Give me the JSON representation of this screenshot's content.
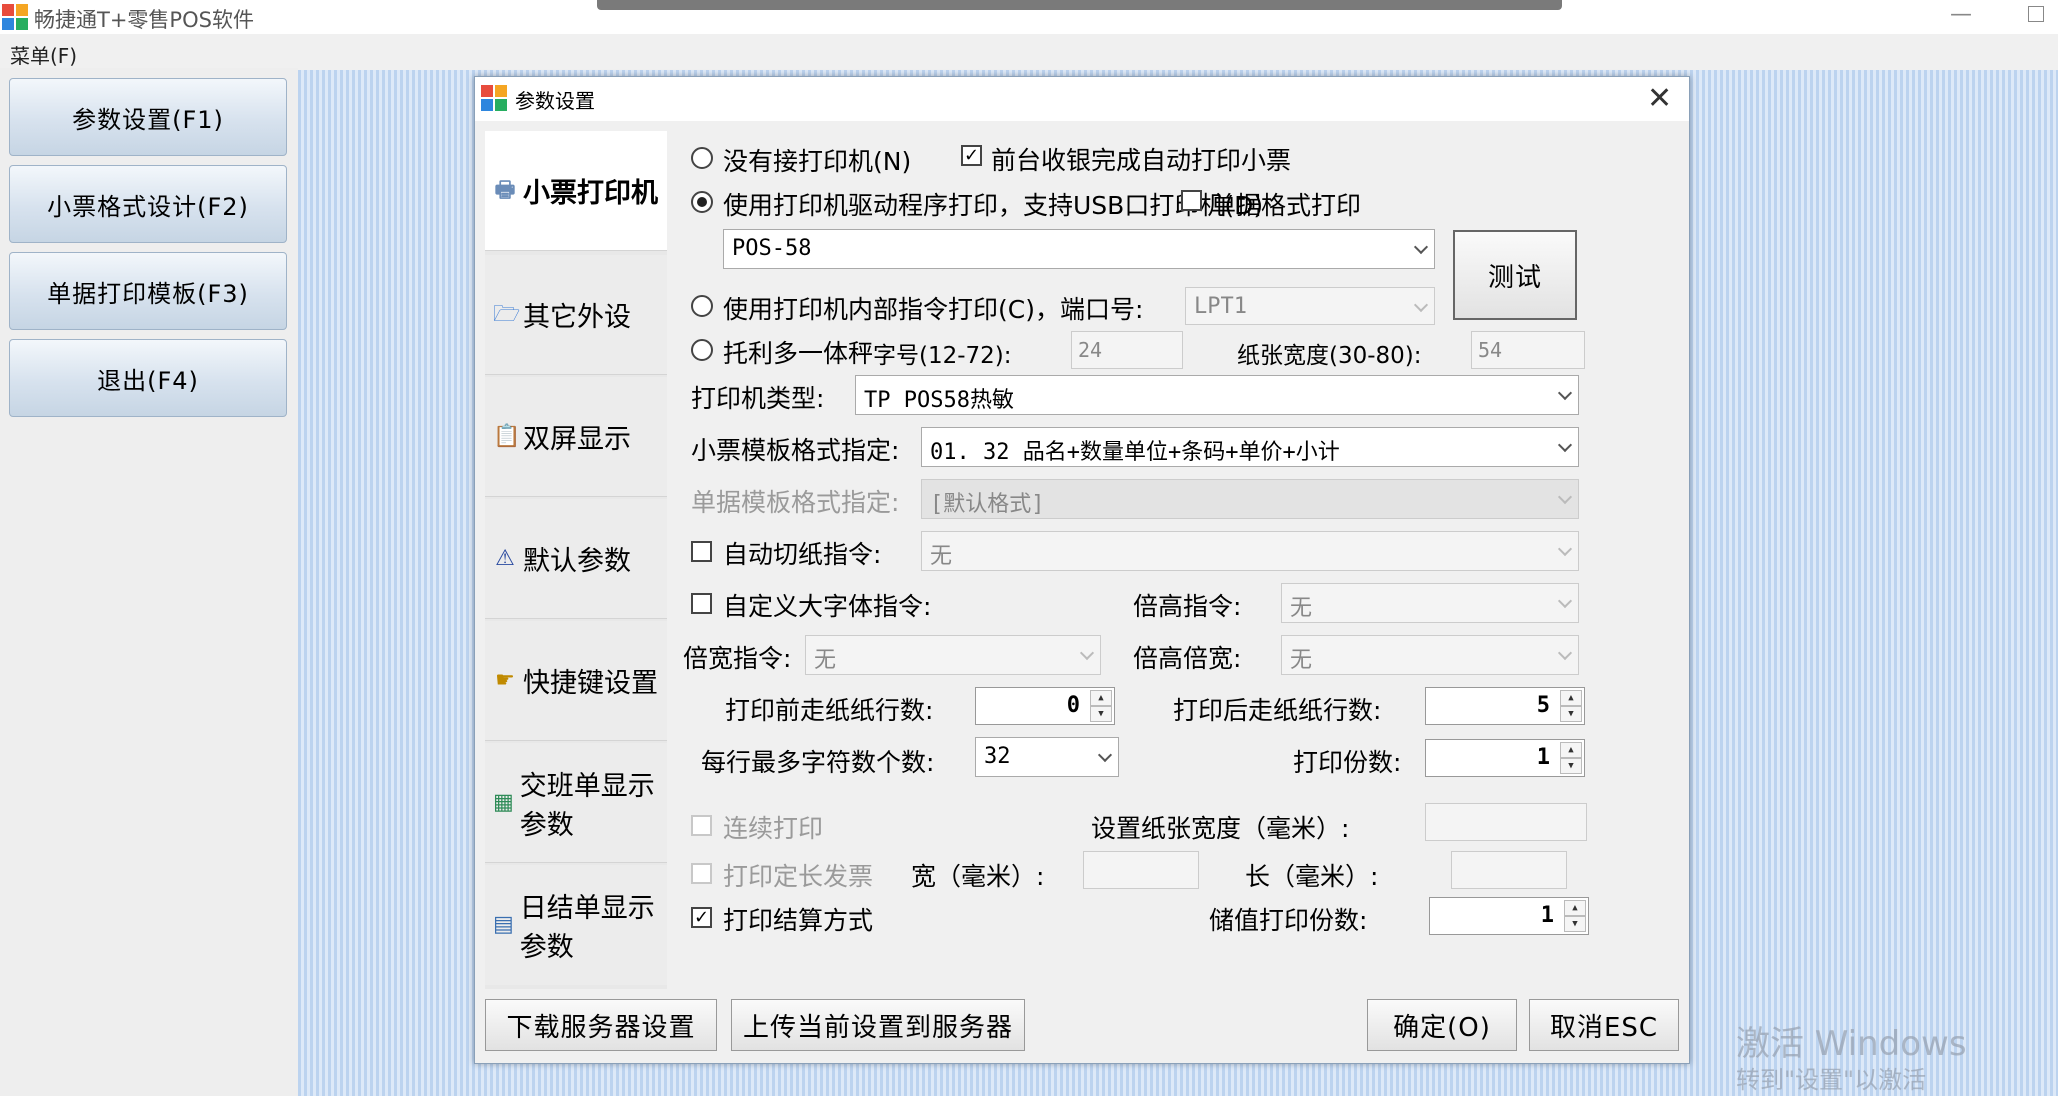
{
  "app": {
    "title": "畅捷通T+零售POS软件",
    "menu": "菜单(F)"
  },
  "sidebar": {
    "items": [
      {
        "label": "参数设置(F1)"
      },
      {
        "label": "小票格式设计(F2)"
      },
      {
        "label": "单据打印模板(F3)"
      },
      {
        "label": "退出(F4)"
      }
    ]
  },
  "dialog": {
    "title": "参数设置",
    "close": "✕",
    "nav": [
      {
        "label": "小票打印机",
        "icon": "printer-icon"
      },
      {
        "label": "其它外设",
        "icon": "folder-icon"
      },
      {
        "label": "双屏显示",
        "icon": "clipboard-icon"
      },
      {
        "label": "默认参数",
        "icon": "default-params-icon"
      },
      {
        "label": "快捷键设置",
        "icon": "hand-icon"
      },
      {
        "label": "交班单显示参数",
        "icon": "shift-report-icon"
      },
      {
        "label": "日结单显示参数",
        "icon": "table-icon"
      }
    ],
    "printer": {
      "radio_none": "没有接打印机(N)",
      "auto_print": "前台收银完成自动打印小票",
      "radio_driver": "使用打印机驱动程序打印，支持USB口打印机(D)",
      "doc_format_print": "单据格式打印",
      "driver_select": "POS-58",
      "test_button": "测试",
      "radio_internal": "使用打印机内部指令打印(C)，端口号:",
      "port_select": "LPT1",
      "radio_scale": "托利多一体秤",
      "font_size_label": "字号(12-72):",
      "font_size_value": "24",
      "paper_width_label": "纸张宽度(30-80):",
      "paper_width_value": "54",
      "type_label": "打印机类型:",
      "type_value": "TP POS58热敏",
      "ticket_template_label": "小票模板格式指定:",
      "ticket_template_value": "01. 32 品名+数量单位+条码+单价+小计",
      "doc_template_label": "单据模板格式指定:",
      "doc_template_value": "[默认格式]",
      "auto_cut_label": "自动切纸指令:",
      "auto_cut_value": "无",
      "big_font_label": "自定义大字体指令:",
      "double_height_label": "倍高指令:",
      "double_height_value": "无",
      "double_width_label": "倍宽指令:",
      "double_width_value": "无",
      "double_hw_label": "倍高倍宽:",
      "double_hw_value": "无",
      "feed_before_label": "打印前走纸纸行数:",
      "feed_before_value": "0",
      "feed_after_label": "打印后走纸纸行数:",
      "feed_after_value": "5",
      "max_chars_label": "每行最多字符数个数:",
      "max_chars_value": "32",
      "copies_label": "打印份数:",
      "copies_value": "1",
      "continuous_label": "连续打印",
      "set_paper_width_label": "设置纸张宽度（毫米）:",
      "fixed_invoice_label": "打印定长发票",
      "width_mm_label": "宽（毫米）:",
      "length_mm_label": "长（毫米）:",
      "print_settlement_label": "打印结算方式",
      "stored_value_copies_label": "储值打印份数:",
      "stored_value_copies_value": "1"
    },
    "buttons": {
      "download": "下载服务器设置",
      "upload": "上传当前设置到服务器",
      "ok": "确定(O)",
      "cancel": "取消ESC"
    }
  },
  "watermark": {
    "line1": "激活 Windows",
    "line2": "转到\"设置\"以激活 Windows。"
  }
}
